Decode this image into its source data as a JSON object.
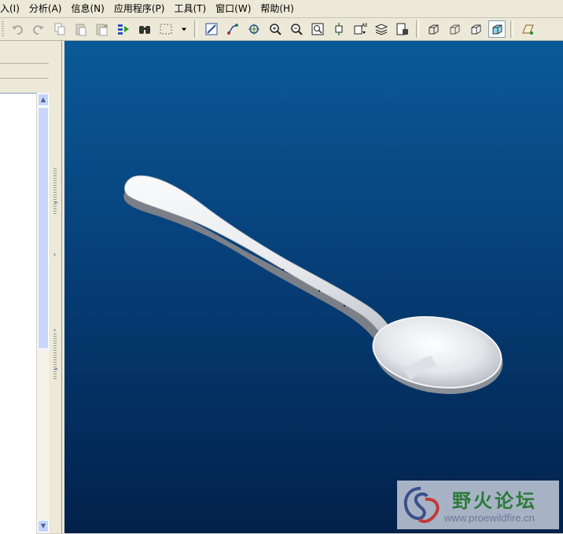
{
  "menu": [
    {
      "label": "入(I)",
      "id": "insert"
    },
    {
      "label": "分析(A)",
      "id": "analysis"
    },
    {
      "label": "信息(N)",
      "id": "info"
    },
    {
      "label": "应用程序(P)",
      "id": "applications"
    },
    {
      "label": "工具(T)",
      "id": "tools"
    },
    {
      "label": "窗口(W)",
      "id": "window"
    },
    {
      "label": "帮助(H)",
      "id": "help"
    }
  ],
  "toolbar": {
    "groups": [
      [
        "undo-icon",
        "redo-icon",
        "copy-icon",
        "paste-icon",
        "paste-special-icon",
        "regenerate-icon",
        "find-icon",
        "select-box-icon",
        "dropdown-arrow-icon"
      ],
      [
        "repaint-icon",
        "spin-center-icon",
        "orient-mode-icon",
        "zoom-in-icon",
        "zoom-out-icon",
        "refit-icon",
        "reorient-icon",
        "saved-views-icon",
        "layers-icon",
        "view-manager-icon"
      ],
      [
        "wireframe-icon",
        "hidden-line-icon",
        "no-hidden-icon",
        "shading-icon"
      ],
      [
        "datum-plane-icon"
      ]
    ]
  },
  "model": {
    "name": "spoon-model",
    "colors": {
      "bg_top": "#0b5a98",
      "bg_bottom": "#02214a",
      "metal": "#e6e8ec"
    }
  },
  "watermark": {
    "title": "野火论坛",
    "url": "www.proewildfire.cn"
  }
}
